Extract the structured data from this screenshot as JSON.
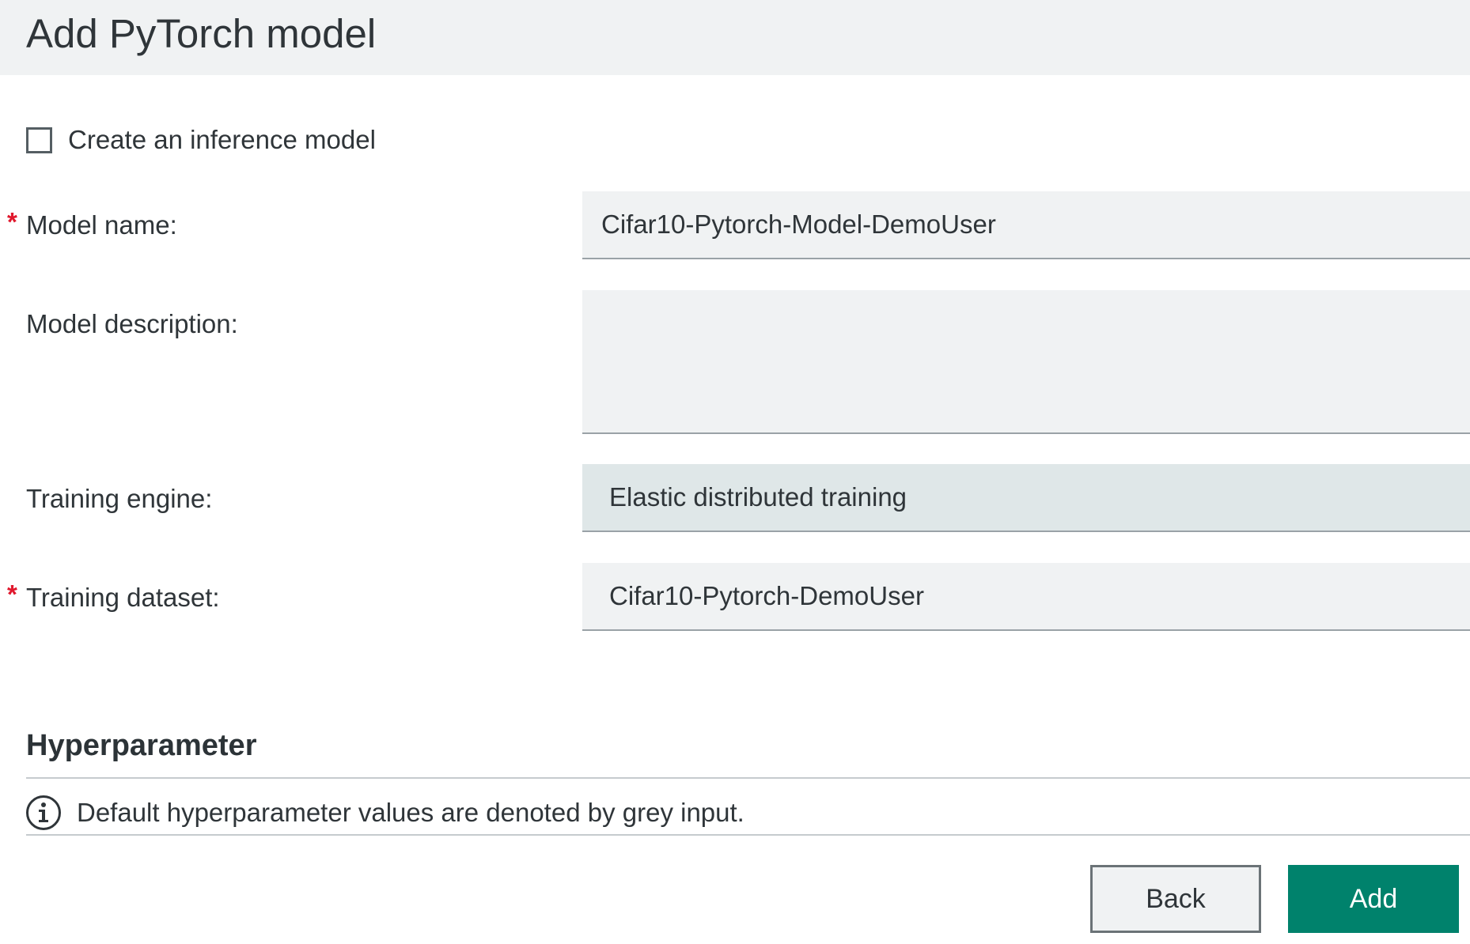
{
  "header": {
    "title": "Add PyTorch model"
  },
  "inference_checkbox": {
    "label": "Create an inference model",
    "checked": false
  },
  "form": {
    "required_marker": "*",
    "model_name": {
      "label": "Model name:",
      "value": "Cifar10-Pytorch-Model-DemoUser"
    },
    "model_description": {
      "label": "Model description:",
      "value": ""
    },
    "training_engine": {
      "label": "Training engine:",
      "value": "Elastic distributed training"
    },
    "training_dataset": {
      "label": "Training dataset:",
      "value": "Cifar10-Pytorch-DemoUser"
    }
  },
  "hyperparameter": {
    "title": "Hyperparameter",
    "info": "Default hyperparameter values are denoted by grey input."
  },
  "buttons": {
    "back": "Back",
    "add": "Add"
  },
  "colors": {
    "primary": "#00826c",
    "required": "#e0182d",
    "field_bg": "#f0f2f3",
    "readonly_bg": "#dfe7e8"
  }
}
